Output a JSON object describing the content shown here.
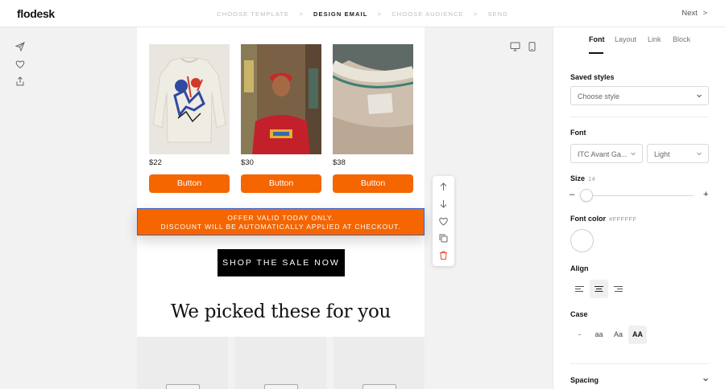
{
  "app": {
    "logo": "flodesk"
  },
  "steps": [
    {
      "label": "CHOOSE TEMPLATE",
      "active": false
    },
    {
      "label": "DESIGN EMAIL",
      "active": true
    },
    {
      "label": "CHOOSE AUDIENCE",
      "active": false
    },
    {
      "label": "SEND",
      "active": false
    }
  ],
  "step_separator": ">",
  "header": {
    "next_label": "Next",
    "next_icon": ">"
  },
  "left_rail": [
    "send-icon",
    "heart-icon",
    "share-icon"
  ],
  "email": {
    "products": [
      {
        "price": "$22",
        "button": "Button"
      },
      {
        "price": "$30",
        "button": "Button"
      },
      {
        "price": "$38",
        "button": "Button"
      }
    ],
    "offer_line1": "OFFER VALID TODAY ONLY.",
    "offer_line2": "DISCOUNT WILL BE AUTOMATICALLY APPLIED AT CHECKOUT.",
    "shop_button": "SHOP THE SALE NOW",
    "heading": "We picked these for you",
    "accent_color": "#f56500",
    "selection_color": "#3b63d6"
  },
  "block_tools": [
    "arrow-up-icon",
    "arrow-down-icon",
    "heart-icon",
    "duplicate-icon",
    "trash-icon"
  ],
  "devices": [
    "desktop-icon",
    "mobile-icon"
  ],
  "panel": {
    "tabs": [
      "Font",
      "Layout",
      "Link",
      "Block"
    ],
    "active_tab": "Font",
    "saved_styles_label": "Saved styles",
    "saved_styles_placeholder": "Choose style",
    "font_label": "Font",
    "font_family": "ITC Avant Ga...",
    "font_weight": "Light",
    "size_label": "Size",
    "size_value": "14",
    "minus": "–",
    "plus": "+",
    "font_color_label": "Font color",
    "font_color_value": "#FFFFFF",
    "align_label": "Align",
    "align_options": [
      "align-left-icon",
      "align-center-icon",
      "align-right-icon"
    ],
    "align_selected": "align-center-icon",
    "case_label": "Case",
    "case_options": [
      "-",
      "aa",
      "Aa",
      "AA"
    ],
    "case_selected": "AA",
    "spacing_label": "Spacing"
  }
}
